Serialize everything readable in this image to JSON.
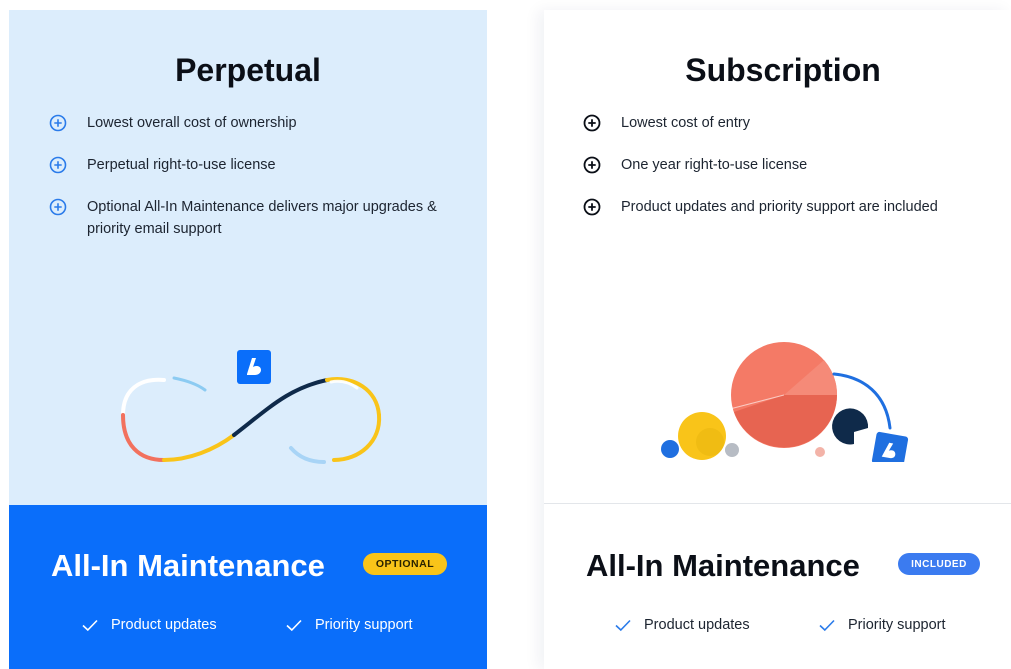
{
  "perpetual": {
    "title": "Perpetual",
    "features": [
      "Lowest overall cost of ownership",
      "Perpetual right-to-use license",
      "Optional All-In Maintenance delivers major upgrades & priority email support"
    ],
    "maintenance": {
      "title": "All-In Maintenance",
      "badge": "OPTIONAL",
      "checks": [
        "Product updates",
        "Priority support"
      ]
    }
  },
  "subscription": {
    "title": "Subscription",
    "features": [
      "Lowest cost of entry",
      "One year right-to-use license",
      "Product updates and priority support are included"
    ],
    "maintenance": {
      "title": "All-In Maintenance",
      "badge": "INCLUDED",
      "checks": [
        "Product updates",
        "Priority support"
      ]
    }
  },
  "icons": {
    "feature_left": "plus-circle-icon",
    "feature_right": "plus-circle-icon",
    "check": "check-icon",
    "brand": "bricsys-logo-icon"
  },
  "colors": {
    "left_bg": "#dcedfc",
    "left_accent": "#0a6efa",
    "optional_badge": "#f9c419",
    "included_badge": "#3b7bf0",
    "pie_coral": "#f2715e",
    "yellow": "#f9c419",
    "navy": "#0f2a4a"
  }
}
